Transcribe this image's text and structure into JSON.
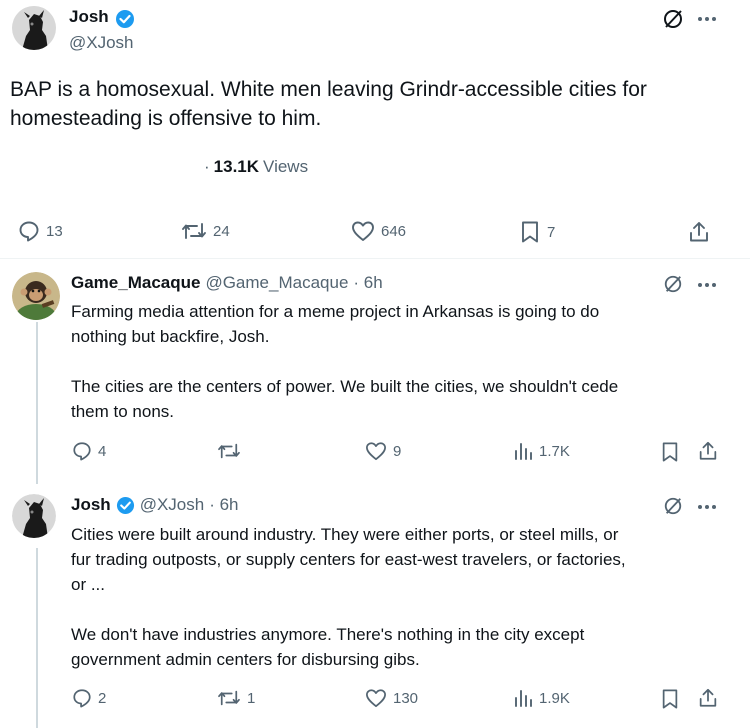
{
  "main_post": {
    "name": "Josh",
    "handle": "@XJosh",
    "text_line1": "BAP is a homosexual. White men leaving Grindr-accessible cities for",
    "text_line2": "homesteading is offensive to him.",
    "views_dot": "·",
    "views_count": "13.1K",
    "views_label": "Views",
    "replies": "13",
    "reposts": "24",
    "likes": "646",
    "bookmarks": "7"
  },
  "reply1": {
    "name": "Game_Macaque",
    "handle": "@Game_Macaque",
    "time": "· 6h",
    "lines": [
      "Farming media attention for a meme project in Arkansas is going to do",
      "nothing but backfire, Josh.",
      "The cities are the centers of power. We built the cities, we shouldn't cede",
      "them to nons."
    ],
    "replies": "4",
    "likes": "9",
    "views": "1.7K"
  },
  "reply2": {
    "name": "Josh",
    "handle": "@XJosh",
    "time": "· 6h",
    "lines": [
      "Cities were built around industry. They were either ports, or steel mills, or",
      "fur trading outposts, or supply centers for east-west travelers, or factories,",
      "or ...",
      "We don't have industries anymore. There's nothing in the city except",
      "government admin centers for disbursing gibs."
    ],
    "replies": "2",
    "reposts": "1",
    "likes": "130",
    "views": "1.9K"
  },
  "colors": {
    "verified": "#1d9bf0",
    "gray": "#536471",
    "text": "#0f1419",
    "divider": "#eff3f4"
  },
  "icons": [
    "grok-icon",
    "more-icon",
    "reply-icon",
    "repost-icon",
    "like-icon",
    "bookmark-icon",
    "share-icon",
    "views-icon",
    "verified-badge-icon"
  ]
}
